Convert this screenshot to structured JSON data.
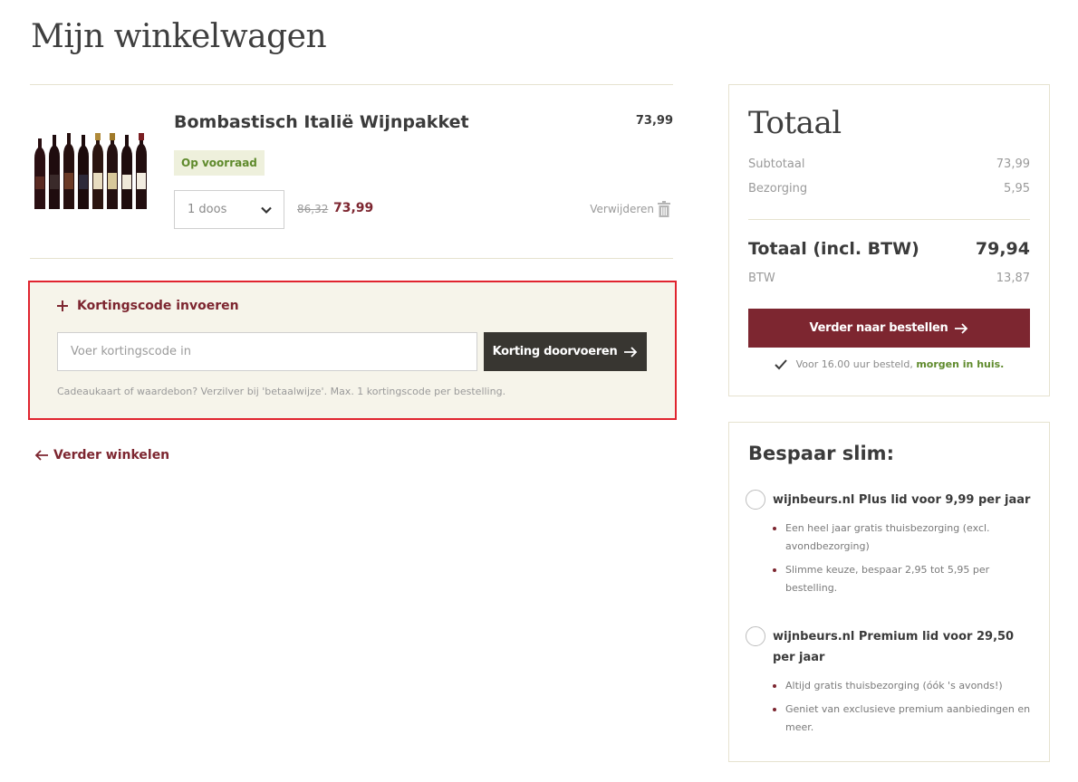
{
  "page": {
    "title": "Mijn winkelwagen"
  },
  "cart": {
    "item": {
      "name": "Bombastisch Italië Wijnpakket",
      "price": "73,99",
      "stock": "Op voorraad",
      "quantity": "1 doos",
      "old_price": "86,32",
      "new_price": "73,99",
      "remove_label": "Verwijderen"
    }
  },
  "discount": {
    "toggle_label": "Kortingscode invoeren",
    "input_placeholder": "Voer kortingscode in",
    "input_value": "",
    "button_label": "Korting doorvoeren",
    "note": "Cadeaukaart of waardebon? Verzilver bij 'betaalwijze'. Max. 1 kortingscode per bestelling."
  },
  "continue_label": "Verder winkelen",
  "totals": {
    "title": "Totaal",
    "subtotal_label": "Subtotaal",
    "subtotal_value": "73,99",
    "shipping_label": "Bezorging",
    "shipping_value": "5,95",
    "total_label": "Totaal (incl. BTW)",
    "total_value": "79,94",
    "vat_label": "BTW",
    "vat_value": "13,87",
    "order_button": "Verder naar bestellen",
    "delivery_text": "Voor 16.00 uur besteld,",
    "delivery_highlight": "morgen in huis."
  },
  "savings": {
    "title": "Bespaar slim:",
    "plans": [
      {
        "label": "wijnbeurs.nl Plus lid voor 9,99 per jaar",
        "benefits": [
          "Een heel jaar gratis thuisbezorging (excl. avondbezorging)",
          "Slimme keuze, bespaar 2,95 tot 5,95 per bestelling."
        ]
      },
      {
        "label": "wijnbeurs.nl Premium lid voor 29,50 per jaar",
        "benefits": [
          "Altijd gratis thuisbezorging (óók 's avonds!)",
          "Geniet van exclusieve premium aanbiedingen en meer."
        ]
      }
    ]
  },
  "colors": {
    "accent": "#7d2630",
    "dark_button": "#383631",
    "stock_green": "#5f8a2c",
    "highlight_border": "#e0242f"
  },
  "icons": {
    "quantity": "chevron-down-icon",
    "remove": "trash-icon",
    "discount": "plus-icon",
    "apply": "arrow-right-icon",
    "continue": "arrow-left-icon",
    "delivery": "check-icon"
  }
}
